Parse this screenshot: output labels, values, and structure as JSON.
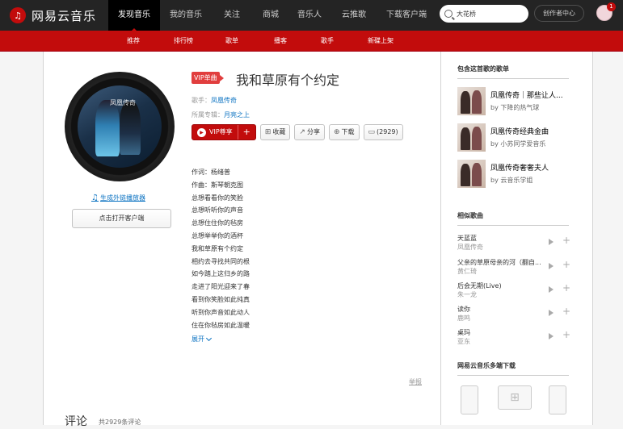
{
  "brand": {
    "name": "网易云音乐",
    "accent": "#c20c0c"
  },
  "topnav": [
    "发现音乐",
    "我的音乐",
    "关注",
    "商城",
    "音乐人",
    "云推歌",
    "下载客户端"
  ],
  "search": {
    "value": "大花桥"
  },
  "creator_label": "创作者中心",
  "badge_count": "1",
  "subnav": [
    "推荐",
    "排行榜",
    "歌单",
    "播客",
    "歌手",
    "新碟上架"
  ],
  "song": {
    "tag": "VIP单曲",
    "title": "我和草原有个约定",
    "singer_label": "歌手：",
    "singer": "凤凰传奇",
    "album_label": "所属专辑：",
    "album": "月亮之上",
    "cover_text": "凤凰传奇"
  },
  "actions": {
    "vip": "VIP尊享",
    "plus": "+",
    "fav": "收藏",
    "share": "分享",
    "download": "下载",
    "comments": "(2929)"
  },
  "ext_link": "生成外链播放器",
  "open_client": "点击打开客户端",
  "lyrics": [
    "作词：杨绪普",
    "作曲：斯琴朝克图",
    "总想看看你的笑脸",
    "总想听听你的声音",
    "总想住住你的毡房",
    "总想举举你的酒杯",
    "我和草原有个约定",
    "相约去寻找共同的根",
    "如今踏上这归乡的路",
    "走进了阳光迎来了春",
    "看到你笑脸如此纯真",
    "听到你声音如此动人",
    "住在你毡房如此温暖"
  ],
  "expand": "展开",
  "report": "举报",
  "comments": {
    "title": "评论",
    "count": "共2929条评论"
  },
  "side": {
    "playlists_title": "包含这首歌的歌单",
    "playlists": [
      {
        "name": "凤凰传奇｜那些让人...",
        "by": "by",
        "user": "下降的热气球"
      },
      {
        "name": "凤凰传奇经典金曲",
        "by": "by",
        "user": "小苏同学爱音乐"
      },
      {
        "name": "凤凰传奇奢奢夫人",
        "by": "by",
        "user": "云音乐学姐"
      }
    ],
    "similar_title": "相似歌曲",
    "similar": [
      {
        "title": "天蓝蓝",
        "artist": "凤凰传奇"
      },
      {
        "title": "父亲的草原母亲的河（翻自...",
        "artist": "黄仁琦"
      },
      {
        "title": "后会无期(Live)",
        "artist": "朱一龙"
      },
      {
        "title": "读你",
        "artist": "鹿鸣"
      },
      {
        "title": "桌玛",
        "artist": "亚东"
      }
    ],
    "download_title": "网易云音乐多端下载"
  }
}
